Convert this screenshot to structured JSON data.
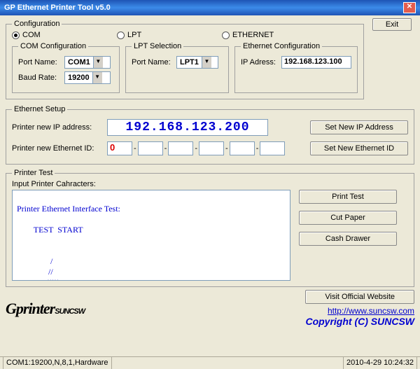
{
  "title": "GP Ethernet Printer Tool v5.0",
  "exit_btn": "Exit",
  "config": {
    "legend": "Configuration",
    "radios": {
      "com": "COM",
      "lpt": "LPT",
      "ethernet": "ETHERNET"
    },
    "com": {
      "legend": "COM Configuration",
      "port_label": "Port Name:",
      "port_value": "COM1",
      "baud_label": "Baud Rate:",
      "baud_value": "19200"
    },
    "lpt": {
      "legend": "LPT Selection",
      "port_label": "Port Name:",
      "port_value": "LPT1"
    },
    "eth": {
      "legend": "Ethernet Configuration",
      "ip_label": "IP Adress:",
      "ip_value": "192.168.123.100"
    }
  },
  "ethernet_setup": {
    "legend": "Ethernet Setup",
    "ip_label": "Printer new IP address:",
    "ip_value": "192.168.123.200",
    "set_ip_btn": "Set New IP Address",
    "id_label": "Printer new Ethernet ID:",
    "id_values": [
      "0",
      "",
      "",
      "",
      "",
      ""
    ],
    "set_id_btn": "Set New Ethernet ID"
  },
  "printer_test": {
    "legend": "Printer Test",
    "input_label": "Input Printer Cahracters:",
    "textarea_content": "\nPrinter Ethernet Interface Test:\n\n        TEST  START\n\n\n                /\n               //\n              /////",
    "print_btn": "Print Test",
    "cut_btn": "Cut Paper",
    "drawer_btn": "Cash Drawer"
  },
  "footer": {
    "visit_btn": "Visit Official Website",
    "url": "http://www.suncsw.com",
    "copyright": "Copyright (C) SUNCSW"
  },
  "statusbar": {
    "left": "COM1:19200,N,8,1,Hardware",
    "right": "2010-4-29  10:24:32"
  }
}
